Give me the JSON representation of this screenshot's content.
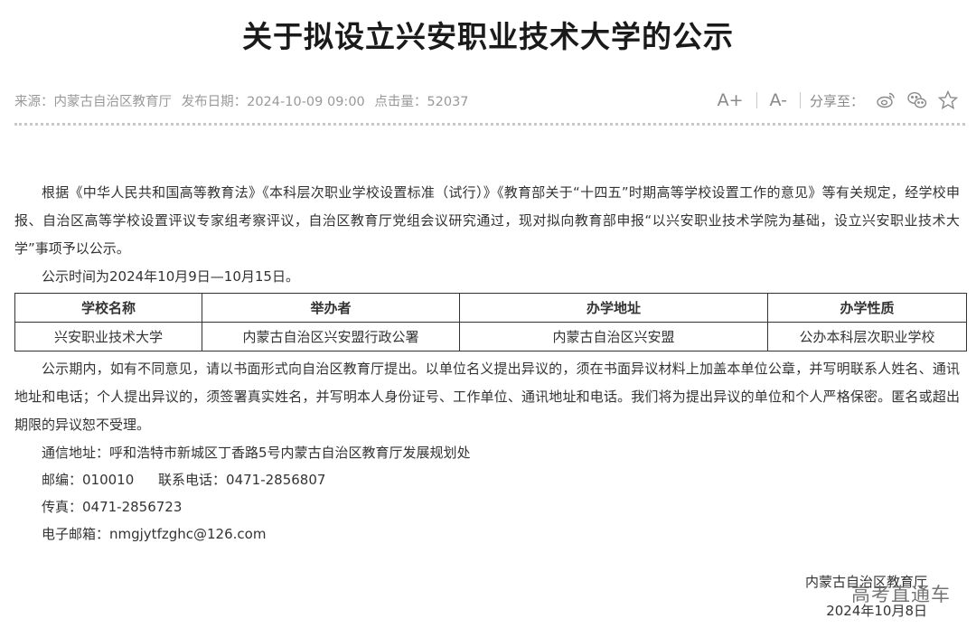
{
  "article": {
    "title": "关于拟设立兴安职业技术大学的公示",
    "source": "来源：内蒙古自治区教育厅",
    "publish_date": "发布日期：2024-10-09 09:00",
    "hits": "点击量：52037"
  },
  "tools": {
    "font_increase": "A+",
    "font_decrease": "A-",
    "share_label": "分享至："
  },
  "content": {
    "para1": "根据《中华人民共和国高等教育法》《本科层次职业学校设置标准（试行）》《教育部关于“十四五”时期高等学校设置工作的意见》等有关规定，经学校申报、自治区高等学校设置评议专家组考察评议，自治区教育厅党组会议研究通过，现对拟向教育部申报“以兴安职业技术学院为基础，设立兴安职业技术大学”事项予以公示。",
    "para2": "公示时间为2024年10月9日—10月15日。",
    "table": {
      "headers": [
        "学校名称",
        "举办者",
        "办学地址",
        "办学性质"
      ],
      "row": [
        "兴安职业技术大学",
        "内蒙古自治区兴安盟行政公署",
        "内蒙古自治区兴安盟",
        "公办本科层次职业学校"
      ]
    },
    "para3": "公示期内，如有不同意见，请以书面形式向自治区教育厅提出。以单位名义提出异议的，须在书面异议材料上加盖本单位公章，并写明联系人姓名、通讯地址和电话；个人提出异议的，须签署真实姓名，并写明本人身份证号、工作单位、通讯地址和电话。我们将为提出异议的单位和个人严格保密。匿名或超出期限的异议恕不受理。",
    "address": "通信地址：呼和浩特市新城区丁香路5号内蒙古自治区教育厅发展规划处",
    "postcode": "邮编：010010",
    "phone": "联系电话：0471-2856807",
    "fax": "传真：0471-2856723",
    "email": "电子邮箱：nmgjytfzghc@126.com"
  },
  "signature": {
    "org": "内蒙古自治区教育厅",
    "date": "2024年10月8日"
  },
  "watermark": "高考直通车"
}
